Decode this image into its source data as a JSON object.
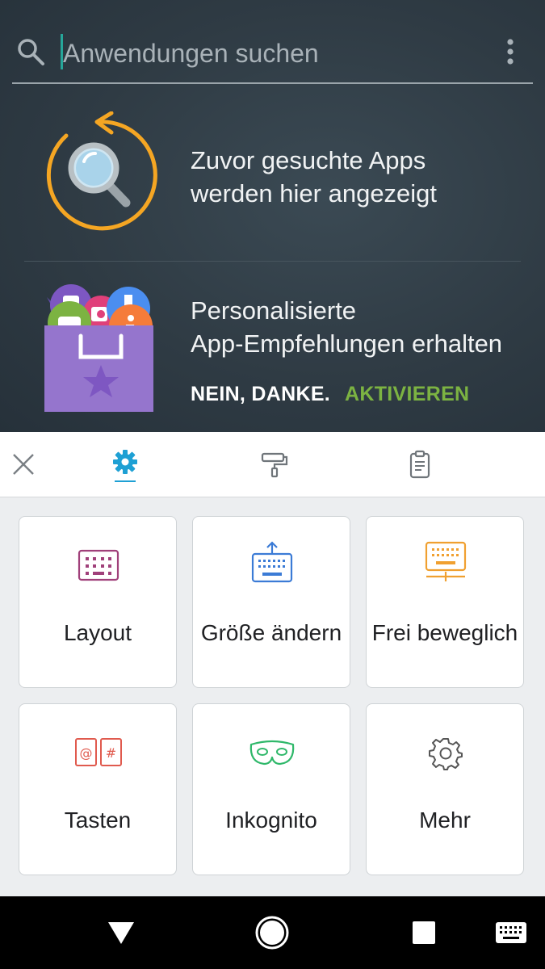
{
  "search": {
    "placeholder": "Anwendungen suchen"
  },
  "recent": {
    "line1": "Zuvor gesuchte Apps",
    "line2": "werden hier angezeigt"
  },
  "promo": {
    "line1": "Personalisierte",
    "line2": "App-Empfehlungen erhalten",
    "decline_label": "NEIN, DANKE.",
    "activate_label": "AKTIVIEREN"
  },
  "toolbar": {
    "icons": [
      "close-icon",
      "gear-icon",
      "paint-roller-icon",
      "clipboard-icon"
    ],
    "active_tab": "settings"
  },
  "tiles": [
    {
      "label": "Layout",
      "icon": "keyboard-layout-icon",
      "color": "#a0407a"
    },
    {
      "label": "Größe ändern",
      "icon": "resize-keyboard-icon",
      "color": "#3b7bd6"
    },
    {
      "label": "Frei beweglich",
      "icon": "floating-keyboard-icon",
      "color": "#f0a030"
    },
    {
      "label": "Tasten",
      "icon": "keys-icon",
      "color": "#e05a4e"
    },
    {
      "label": "Inkognito",
      "icon": "incognito-mask-icon",
      "color": "#2fb86a"
    },
    {
      "label": "Mehr",
      "icon": "gear-outline-icon",
      "color": "#555555"
    }
  ],
  "colors": {
    "accent": "#7cb342",
    "tab_active": "#1ea0d4",
    "background": "#2f3b44"
  }
}
